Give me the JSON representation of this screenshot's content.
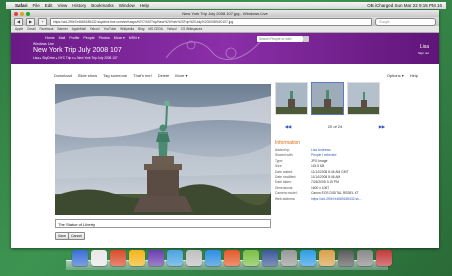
{
  "menubar": {
    "apple": "",
    "items": [
      "Safari",
      "File",
      "Edit",
      "View",
      "History",
      "Bookmarks",
      "Window",
      "Help"
    ],
    "right": "OB iCharged  Sun Mar 22  9:15 PM  16"
  },
  "window": {
    "title": "New York Trip July 2008 107.jpg - Windows Live",
    "url": "https://cid-2f0b7e4669185432.skydrive.live.com/self.aspx/NYC%20Trip/New%20York%20Trip%20July%202008%20107.jpg",
    "google_placeholder": "Google",
    "bookmarks": [
      "Apple",
      "Gmail",
      "Facebook",
      "Banner",
      "AppleMail",
      "Yahoo!",
      "YouTube",
      "Wikipedia",
      "Blog",
      "MS CEDA",
      "Yahoo!",
      "CS Wikispaces"
    ]
  },
  "live": {
    "nav": [
      "Home",
      "Mail",
      "Profile",
      "People",
      "Photos",
      "More ▾",
      "MSN ▾"
    ],
    "logo": "Windows Live",
    "user": "Lisa",
    "signout": "Sign out",
    "search_placeholder": "Search People or web",
    "title": "New York Trip July 2008 107",
    "breadcrumb": "Lisa  ▸  SkyDrive  ▸  NYC Trip ▾  ▸  New York Trip July 2008 107"
  },
  "actions": [
    "Download",
    "Slide show",
    "Tag someone",
    "That's me!",
    "Delete",
    "More ▾"
  ],
  "actions_right": [
    "Options ▾",
    "Help"
  ],
  "photo": {
    "caption": "The Statue of Liberty"
  },
  "buttons": {
    "save": "Save",
    "cancel": "Cancel"
  },
  "pager": {
    "prev": "◀◀",
    "text": "20 of 24",
    "next": "▶▶"
  },
  "info": {
    "heading": "Information",
    "rows": [
      {
        "k": "Added by:",
        "v": "Lisa Andrews",
        "link": true
      },
      {
        "k": "Shared with:",
        "v": "People I selected",
        "link": true
      },
      {
        "k": "Type:",
        "v": "JPG Image",
        "link": false
      },
      {
        "k": "Size:",
        "v": "115.5 KB",
        "link": false
      },
      {
        "k": "Date added:",
        "v": "11/14/2008 8:46 AM GMT",
        "link": false
      },
      {
        "k": "Date modified:",
        "v": "11/14/2008 8:46 AM",
        "link": false
      },
      {
        "k": "Date taken:",
        "v": "7/26/2008 3:15 PM",
        "link": false
      },
      {
        "k": "Dimensions:",
        "v": "1600 x 1067",
        "link": false
      },
      {
        "k": "Camera model:",
        "v": "Canon EOS DIGITAL REBEL XT",
        "link": false
      },
      {
        "k": "Web address:",
        "v": "https://cid-2f0b7e4669185432.sk...",
        "link": true
      }
    ]
  },
  "dock_colors": [
    "#3a6fd8",
    "#e8e8e8",
    "#d94c2a",
    "#f2b61c",
    "#6a3fb0",
    "#4aa3e0",
    "#c0c0c0",
    "#2c8ee0",
    "#e45a2a",
    "#7bc043",
    "#3b5998",
    "#999999",
    "#2f9de4",
    "#d9a14a",
    "#5b5b5b",
    "#8a8a8a",
    "#c23a3a"
  ]
}
